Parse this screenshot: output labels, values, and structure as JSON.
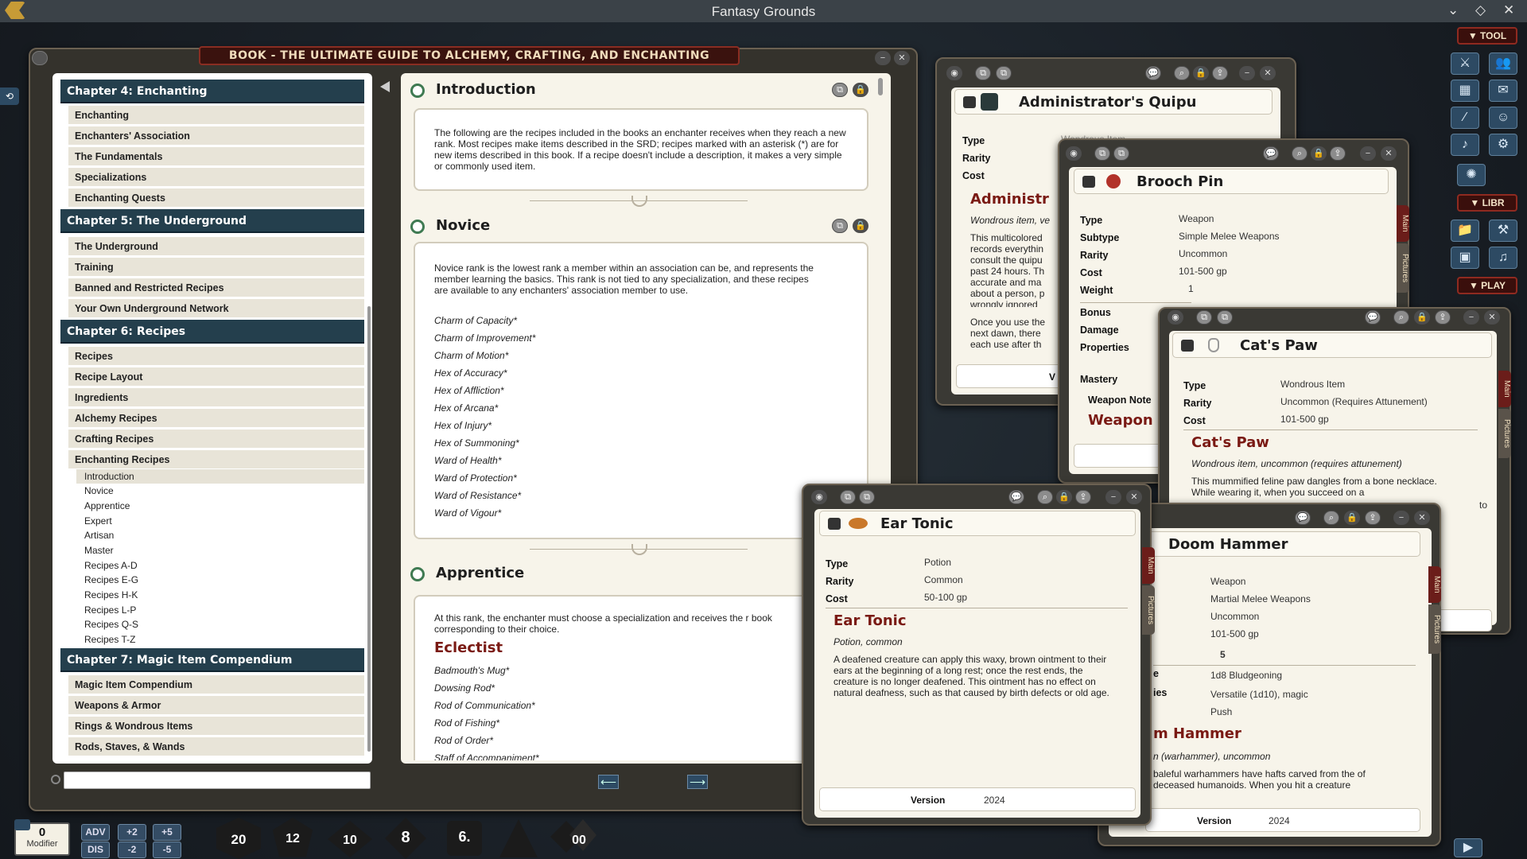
{
  "app": {
    "title": "Fantasy Grounds"
  },
  "book": {
    "title": "BOOK - THE ULTIMATE GUIDE TO ALCHEMY, CRAFTING, AND ENCHANTING",
    "toc": {
      "ch4": "Chapter 4: Enchanting",
      "ch4_items": [
        "Enchanting",
        "Enchanters' Association",
        "The Fundamentals",
        "Specializations",
        "Enchanting Quests"
      ],
      "ch5": "Chapter 5: The Underground",
      "ch5_items": [
        "The Underground",
        "Training",
        "Banned and Restricted Recipes",
        "Your Own Underground Network"
      ],
      "ch6": "Chapter 6: Recipes",
      "ch6_items": [
        "Recipes",
        "Recipe Layout",
        "Ingredients",
        "Alchemy Recipes",
        "Crafting Recipes",
        "Enchanting Recipes"
      ],
      "ch6_sub": [
        "Introduction",
        "Novice",
        "Apprentice",
        "Expert",
        "Artisan",
        "Master",
        "Recipes A-D",
        "Recipes E-G",
        "Recipes H-K",
        "Recipes L-P",
        "Recipes Q-S",
        "Recipes T-Z"
      ],
      "ch7": "Chapter 7: Magic Item Compendium",
      "ch7_items": [
        "Magic Item Compendium",
        "Weapons & Armor",
        "Rings & Wondrous Items",
        "Rods, Staves, & Wands"
      ]
    },
    "content": {
      "intro_title": "Introduction",
      "intro_text": "The following are the recipes included in the books an enchanter receives when they reach a new rank. Most recipes make items described in the SRD; recipes marked with an asterisk (*) are for new items described in this book. If a recipe doesn't include a description, it makes a very simple or commonly used item.",
      "novice_title": "Novice",
      "novice_text": "Novice rank is the lowest rank a member within an association can be, and represents the member learning the basics. This rank is not tied to any specialization, and these recipes are available to any enchanters' association member to use.",
      "novice_list": [
        "Charm of Capacity*",
        "Charm of Improvement*",
        "Charm of Motion*",
        "Hex of Accuracy*",
        "Hex of Affliction*",
        "Hex of Arcana*",
        "Hex of Injury*",
        "Hex of Summoning*",
        "Ward of Health*",
        "Ward of Protection*",
        "Ward of Resistance*",
        "Ward of Vigour*"
      ],
      "apprentice_title": "Apprentice",
      "apprentice_text": "At this rank, the enchanter must choose a specialization and receives the r book corresponding to their choice.",
      "eclectist": "Eclectist",
      "eclectist_list": [
        "Badmouth's Mug*",
        "Dowsing Rod*",
        "Rod of Communication*",
        "Rod of Fishing*",
        "Rod of Order*",
        "Staff of Accompaniment*"
      ]
    }
  },
  "quipu": {
    "name": "Administrator's Quipu",
    "type_label": "Type",
    "type_value": "Wondrous Item",
    "rarity_label": "Rarity",
    "cost_label": "Cost",
    "heading": "Administr",
    "sub": "Wondrous item, ve",
    "desc": "This multicolored records everythin consult the quipu past 24 hours. Th accurate and ma about a person, p wrongly ignored",
    "desc2": "Once you use the next dawn, there each use after th",
    "footer": "V"
  },
  "brooch": {
    "name": "Brooch Pin",
    "rows": [
      [
        "Type",
        "Weapon"
      ],
      [
        "Subtype",
        "Simple Melee Weapons"
      ],
      [
        "Rarity",
        "Uncommon"
      ],
      [
        "Cost",
        "101-500 gp"
      ],
      [
        "Weight",
        "1"
      ],
      [
        "Bonus",
        ""
      ],
      [
        "Damage",
        ""
      ],
      [
        "Properties",
        ""
      ],
      [
        "Mastery",
        ""
      ],
      [
        "Weapon Note",
        ""
      ]
    ],
    "heading": "Weapon"
  },
  "catspaw": {
    "name": "Cat's Paw",
    "rows": [
      [
        "Type",
        "Wondrous Item"
      ],
      [
        "Rarity",
        "Uncommon (Requires Attunement)"
      ],
      [
        "Cost",
        "101-500 gp"
      ]
    ],
    "heading": "Cat's Paw",
    "sub": "Wondrous item, uncommon (requires attunement)",
    "desc": "This mummified feline paw dangles from a bone necklace. While wearing it, when you succeed on a",
    "to": "to"
  },
  "doomhammer": {
    "name": "Doom Hammer",
    "rows": [
      "Weapon",
      "Martial Melee Weapons",
      "Uncommon",
      "101-500 gp",
      "5",
      "1d8 Bludgeoning",
      "Versatile (1d10), magic",
      "Push"
    ],
    "row_labels": [
      "",
      "",
      "",
      "",
      "",
      "e",
      "ies",
      ""
    ],
    "heading": "m Hammer",
    "sub": "n (warhammer), uncommon",
    "desc": "baleful warhammers have hafts carved from the of deceased humanoids. When you hit a creature",
    "version_label": "Version",
    "version": "2024"
  },
  "eartonic": {
    "name": "Ear Tonic",
    "rows": [
      [
        "Type",
        "Potion"
      ],
      [
        "Rarity",
        "Common"
      ],
      [
        "Cost",
        "50-100 gp"
      ]
    ],
    "heading": "Ear Tonic",
    "sub": "Potion, common",
    "desc": "A deafened creature can apply this waxy, brown ointment to their ears at the beginning of a long rest; once the rest ends, the creature is no longer deafened. This ointment has no effect on natural deafness, such as that caused by birth defects or old age.",
    "version_label": "Version",
    "version": "2024"
  },
  "tabs": {
    "main": "Main",
    "pictures": "Pictures"
  },
  "sidebar": {
    "tool": "▼ TOOL",
    "libr": "▼ LIBR",
    "play": "▼ PLAY"
  },
  "hotbar": {
    "modifier_value": "0",
    "modifier_label": "Modifier",
    "adv": "ADV",
    "dis": "DIS",
    "p2": "+2",
    "p5": "+5",
    "m2": "-2",
    "m5": "-5",
    "dice": [
      "20",
      "12",
      "10",
      "8",
      "6.",
      "",
      "00"
    ]
  },
  "colors": {
    "chapter_header": "#243f4d",
    "red_heading": "#7a1a14",
    "paper": "#f7f4ea"
  }
}
